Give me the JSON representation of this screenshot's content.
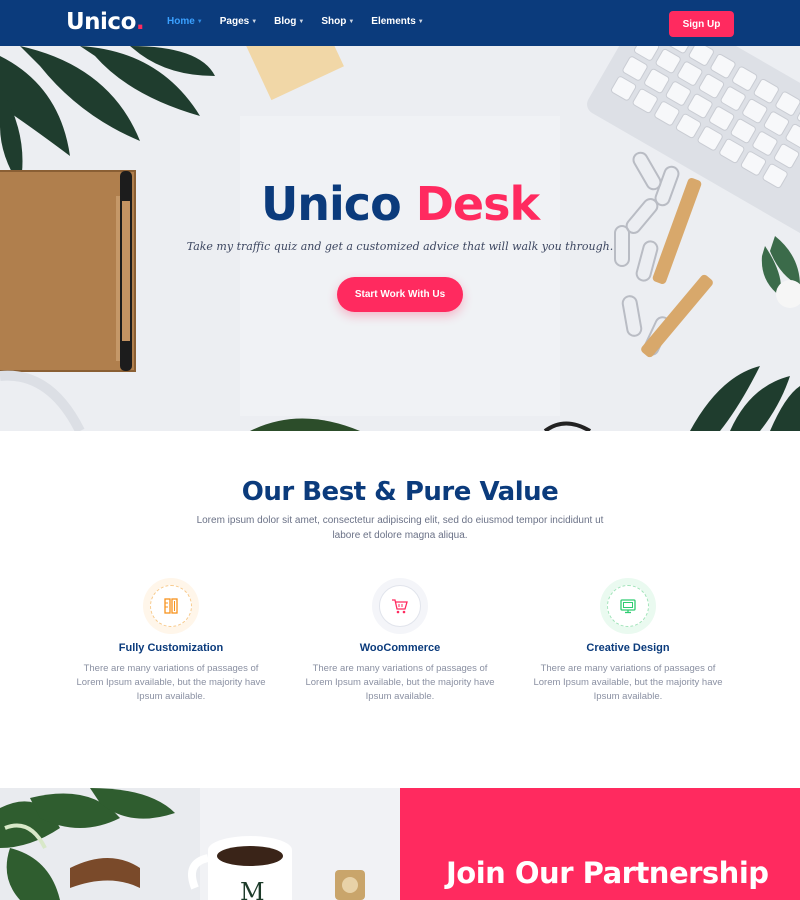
{
  "nav": {
    "logo": "Unico",
    "logo_dot": ".",
    "items": [
      {
        "label": "Home",
        "active": true
      },
      {
        "label": "Pages",
        "active": false
      },
      {
        "label": "Blog",
        "active": false
      },
      {
        "label": "Shop",
        "active": false
      },
      {
        "label": "Elements",
        "active": false
      }
    ],
    "signup_label": "Sign Up"
  },
  "hero": {
    "title_part1": "Unico",
    "title_part2": "Desk",
    "subtitle": "Take my traffic quiz and get a customized advice that will walk you through.",
    "cta_label": "Start Work With Us"
  },
  "value": {
    "title": "Our Best & Pure Value",
    "description": "Lorem ipsum dolor sit amet, consectetur adipiscing elit, sed do eiusmod tempor incididunt ut labore et dolore magna aliqua.",
    "features": [
      {
        "title": "Fully Customization",
        "description": "There are many variations of passages of Lorem Ipsum available, but the majority have Ipsum available.",
        "icon": "pencil-ruler-icon",
        "color": "#f7931e"
      },
      {
        "title": "WooCommerce",
        "description": "There are many variations of passages of Lorem Ipsum available, but the majority have Ipsum available.",
        "icon": "shopping-cart-icon",
        "color": "#ff2a5f"
      },
      {
        "title": "Creative Design",
        "description": "There are many variations of passages of Lorem Ipsum available, but the majority have Ipsum available.",
        "icon": "monitor-icon",
        "color": "#2ecc71"
      }
    ]
  },
  "partnership": {
    "title": "Join Our Partnership"
  },
  "colors": {
    "navy": "#0b3b7c",
    "accent": "#ff2a5f",
    "link_active": "#3aa0ff"
  }
}
